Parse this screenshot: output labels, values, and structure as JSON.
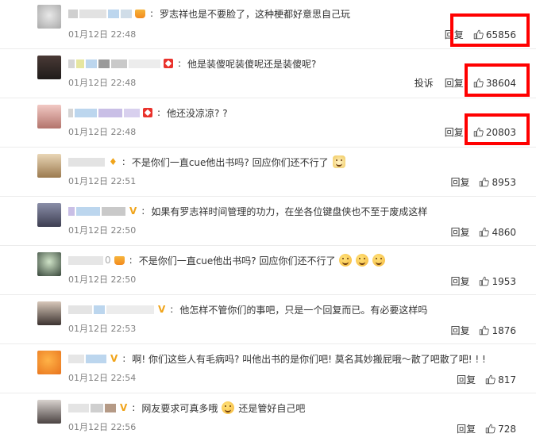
{
  "colors": {
    "accent_red": "#ff0000",
    "vip_gold": "#f0a41a",
    "text": "#333333",
    "meta": "#808080"
  },
  "comments": [
    {
      "text": "罗志祥也是不要脸了，这种梗都好意思自己玩",
      "time": "01月12日 22:48",
      "reply": "回复",
      "likes": "65856",
      "report": ""
    },
    {
      "text": "他是装傻呢装傻呢还是装傻呢?",
      "time": "01月12日 22:48",
      "reply": "回复",
      "likes": "38604",
      "report": "投诉"
    },
    {
      "text": "他还没凉凉? ?",
      "time": "01月12日 22:48",
      "reply": "回复",
      "likes": "20803",
      "report": ""
    },
    {
      "text": "不是你们一直cue他出书吗? 回应你们还不行了",
      "time": "01月12日 22:51",
      "reply": "回复",
      "likes": "8953",
      "report": ""
    },
    {
      "text": "如果有罗志祥时间管理的功力，在坐各位键盘侠也不至于废成这样",
      "time": "01月12日 22:50",
      "reply": "回复",
      "likes": "4860",
      "report": ""
    },
    {
      "text": "不是你们一直cue他出书吗? 回应你们还不行了",
      "time": "01月12日 22:50",
      "reply": "回复",
      "likes": "1953",
      "report": ""
    },
    {
      "text": "他怎样不管你们的事吧，只是一个回复而已。有必要这样吗",
      "time": "01月12日 22:53",
      "reply": "回复",
      "likes": "1876",
      "report": ""
    },
    {
      "text": "啊! 你们这些人有毛病吗? 叫他出书的是你们吧! 莫名其妙搬屁哦～散了吧散了吧! ! !",
      "time": "01月12日 22:54",
      "reply": "回复",
      "likes": "817",
      "report": ""
    },
    {
      "text_a": "网友要求可真多哦",
      "text_b": "还是管好自己吧",
      "time": "01月12日 22:56",
      "reply": "回复",
      "likes": "728",
      "report": ""
    }
  ]
}
